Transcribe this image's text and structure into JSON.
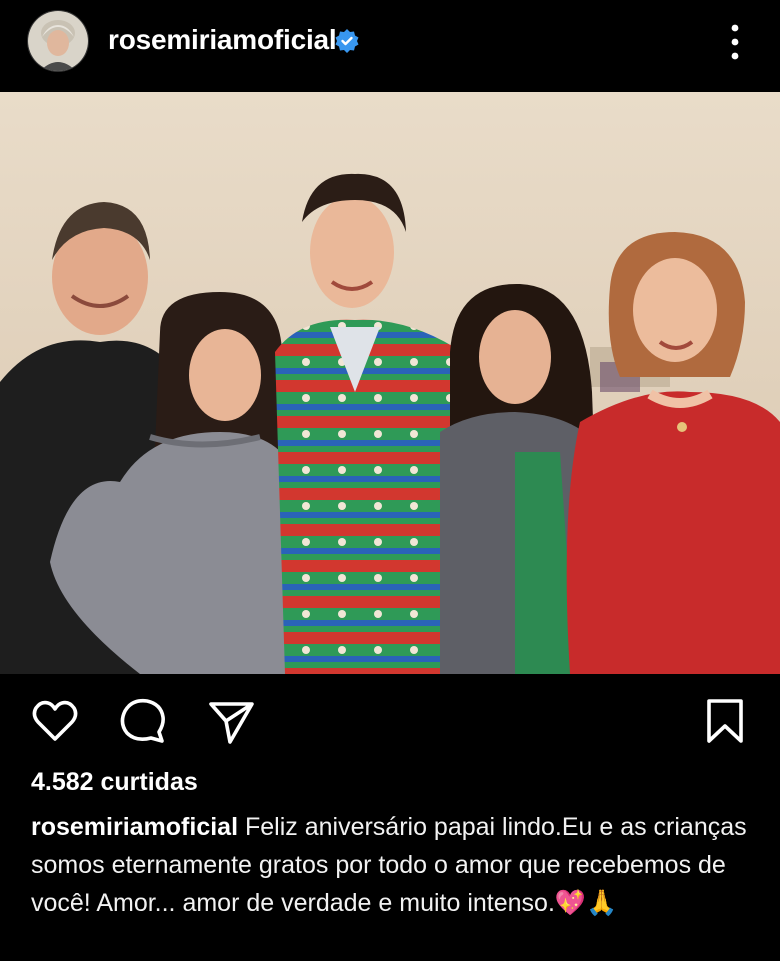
{
  "post": {
    "username": "rosemiriamoficial",
    "likes": "4.582 curtidas",
    "caption": "Feliz aniversário papai lindo.Eu e as crianças somos eternamente gratos por todo o amor que recebemos de você! Amor... amor de verdade e muito intenso.💖🙏"
  },
  "icons": {
    "avatar": "profile-avatar",
    "verified": "verified-badge-icon",
    "more": "more-options-icon",
    "like": "heart-icon",
    "comment": "comment-icon",
    "share": "send-icon",
    "save": "bookmark-icon"
  },
  "colors": {
    "background": "#000000",
    "text": "#ffffff",
    "verified": "#3897f0"
  }
}
